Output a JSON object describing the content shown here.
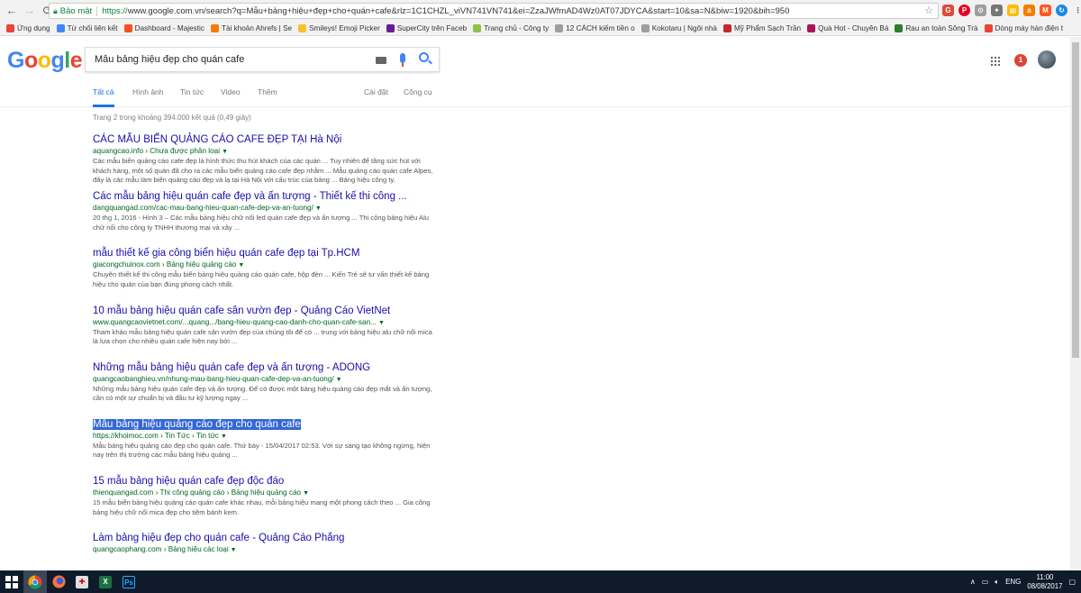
{
  "browser": {
    "secure_label": "Bảo mật",
    "url_protocol": "https://",
    "url_rest": "www.google.com.vn/search?q=Mẫu+bảng+hiệu+đẹp+cho+quán+cafe&rlz=1C1CHZL_viVN741VN741&ei=ZzaJWfmAD4Wz0AT07JDYCA&start=10&sa=N&biw=1920&bih=950"
  },
  "bookmarks": [
    {
      "label": "Ứng dụng",
      "icon": "apps-grid-icon",
      "color": "#e8453c"
    },
    {
      "label": "Từ chối liên kết",
      "icon": "page-icon",
      "color": "#4285f4"
    },
    {
      "label": "Dashboard - Majestic",
      "icon": "star-icon",
      "color": "#f4511e"
    },
    {
      "label": "Tài khoản Ahrefs | Se",
      "icon": "ahrefs-icon",
      "color": "#f57c00"
    },
    {
      "label": "Smileys! Emoji Picker",
      "icon": "smiley-icon",
      "color": "#fbc02d"
    },
    {
      "label": "SuperCity trên Faceb",
      "icon": "supercity-icon",
      "color": "#6a1b9a"
    },
    {
      "label": "Trang chủ - Công ty",
      "icon": "link-icon",
      "color": "#8bc34a"
    },
    {
      "label": "12 CÁCH kiếm tiền o",
      "icon": "page-icon",
      "color": "#9e9e9e"
    },
    {
      "label": "Kokotaru | Ngôi nhà",
      "icon": "page-icon",
      "color": "#9e9e9e"
    },
    {
      "label": "Mỹ Phẩm Sạch Trần",
      "icon": "cosmetics-icon",
      "color": "#c62828"
    },
    {
      "label": "Quà Hot - Chuyên Bá",
      "icon": "gift-icon",
      "color": "#ad1457"
    },
    {
      "label": "Rau an toàn Sông Trà",
      "icon": "leaf-icon",
      "color": "#2e7d32"
    },
    {
      "label": "Dòng máy hàn điện t",
      "icon": "google-icon",
      "color": "#ea4335"
    }
  ],
  "search": {
    "query": "Mẫu bảng hiệu đẹp cho quán cafe",
    "notification_count": "1"
  },
  "tabs": [
    {
      "label": "Tất cả",
      "active": true
    },
    {
      "label": "Hình ảnh"
    },
    {
      "label": "Tin tức"
    },
    {
      "label": "Video"
    },
    {
      "label": "Thêm"
    },
    {
      "label": "Cài đặt"
    },
    {
      "label": "Công cụ"
    }
  ],
  "result_stats": "Trang 2 trong khoảng 394.000 kết quả (0,49 giây)",
  "results": [
    {
      "title": "CÁC MẪU BIỂN QUẢNG CÁO CAFE ĐẸP TẠI Hà Nội",
      "url": "aquangcao.info › Chưa được phân loại",
      "snippet": "Các mẫu biển quảng cáo cafe đẹp là hình thức thu hút khách của các quán ... Tuy nhiên để tăng sức hút với khách hàng, một số quán đã cho ra các mẫu biển quảng cáo cafe đẹp nhằm ... Mẫu quảng cáo quán cafe Alpes, đây là các mẫu làm biển quảng cáo đẹp và lạ tại Hà Nội với cấu trúc của bảng ... Bảng hiệu công ty."
    },
    {
      "title": "Các mẫu bảng hiệu quán cafe đẹp và ấn tượng - Thiết kế thi công ...",
      "url": "dangquangad.com/cac-mau-bang-hieu-quan-cafe-dep-va-an-tuong/",
      "snippet": "20 thg 1, 2016 - Hình 3 – Các mẫu bảng hiệu chữ nổi led quán cafe đẹp và ấn tượng ... Thi công bảng hiệu Alu chữ nổi cho công ty TNHH thương mại và xây ..."
    },
    {
      "title": "mẫu thiết kế gia công biển hiệu quán cafe đẹp tại Tp.HCM",
      "url": "giacongchuinox.com › Bảng hiệu quảng cáo",
      "snippet": "Chuyên thiết kế thi công mẫu biển bảng hiệu quảng cáo quán cafe, hộp đèn ... Kiến Trẻ sẽ tư vấn thiết kế bảng hiệu cho quán của bạn đúng phong cách nhất."
    },
    {
      "title": "10 mẫu bảng hiệu quán cafe sân vườn đẹp - Quảng Cáo VietNet",
      "url": "www.quangcaovietnet.com/...quang.../bang-hieu-quang-cao-danh-cho-quan-cafe-san...",
      "snippet": "Tham khảo mẫu bảng hiệu quán cafe sân vườn đẹp của chúng tôi để có ... trung với bảng hiệu alu chữ nổi mica là lựa chọn cho nhiều quán cafe hiện nay bởi ..."
    },
    {
      "title": "Những mẫu bảng hiệu quán cafe đẹp và ấn tượng - ADONG",
      "url": "quangcaobanghieu.vn/nhung-mau-bang-hieu-quan-cafe-dep-va-an-tuong/",
      "snippet": "Những mẫu bảng hiệu quán cafe đẹp và ấn tượng. Để có được một bảng hiệu quảng cáo đẹp mắt và ấn tượng, cần có một sự chuẩn bị và đầu tư kỹ lượng ngay ..."
    },
    {
      "title": "Mẫu bảng hiệu quảng cáo đẹp cho quán cafe",
      "url": "https://khoimoc.com › Tin Tức › Tin tức",
      "snippet": "Mẫu bảng hiệu quảng cáo đẹp cho quán cafe. Thứ bảy - 15/04/2017 02:53. Với sự sáng tạo không ngừng, hiện nay trên thị trường các mẫu bảng hiệu quảng ...",
      "selected": true
    },
    {
      "title": "15 mẫu bảng hiệu quán cafe đẹp độc đáo",
      "url": "thienquangad.com › Thi công quảng cáo › Bảng hiệu quảng cáo",
      "snippet": "15 mẫu biển bảng hiệu quảng cáo quán cafe khác nhau, mỗi bảng hiệu mang một phong cách theo ... Gia công bảng hiệu chữ nổi mica đẹp cho tiệm bánh kem."
    },
    {
      "title": "Làm bảng hiệu đẹp cho quán cafe - Quảng Cáo Phẳng",
      "url": "quangcaophang.com › Bảng hiệu các loại",
      "snippet": ""
    }
  ],
  "taskbar": {
    "apps": [
      {
        "icon": "windows-start-icon",
        "color": "#ffffff"
      },
      {
        "icon": "chrome-icon",
        "color": "#4285f4"
      },
      {
        "icon": "firefox-icon",
        "color": "#ff7139"
      },
      {
        "icon": "puzzle-app-icon",
        "color": "#e0e0e0"
      },
      {
        "icon": "excel-icon",
        "color": "#1d6f42"
      },
      {
        "icon": "photoshop-icon",
        "color": "#001d34"
      }
    ],
    "language": "ENG",
    "time": "11:00",
    "date": "08/08/2017"
  }
}
